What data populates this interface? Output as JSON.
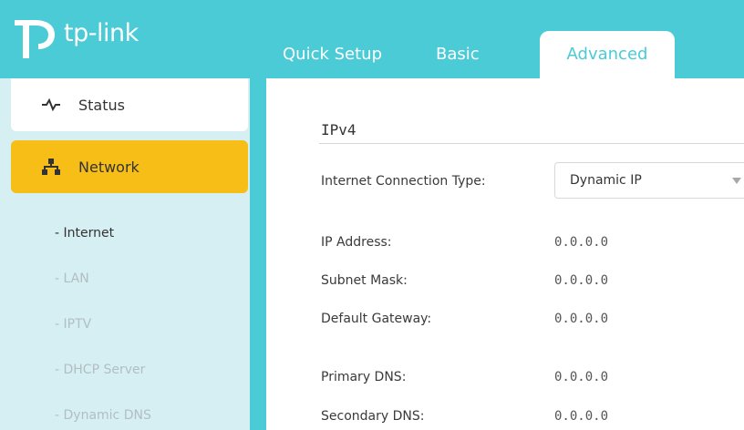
{
  "brand": {
    "logo_text": "tp-link"
  },
  "header": {
    "tabs": [
      {
        "label": "Quick Setup",
        "active": false
      },
      {
        "label": "Basic",
        "active": false
      },
      {
        "label": "Advanced",
        "active": true
      }
    ]
  },
  "sidebar": {
    "items": [
      {
        "label": "Status",
        "icon": "pulse-icon",
        "selected": false
      },
      {
        "label": "Network",
        "icon": "network-icon",
        "selected": true
      }
    ],
    "subitems": [
      {
        "label": "- Internet",
        "active": true
      },
      {
        "label": "- LAN",
        "active": false
      },
      {
        "label": "- IPTV",
        "active": false
      },
      {
        "label": "- DHCP Server",
        "active": false
      },
      {
        "label": "- Dynamic DNS",
        "active": false
      }
    ]
  },
  "main": {
    "section_title": "IPv4",
    "connection_type": {
      "label": "Internet Connection Type:",
      "value": "Dynamic IP"
    },
    "fields": [
      {
        "label": "IP Address:",
        "value": "0.0.0.0"
      },
      {
        "label": "Subnet Mask:",
        "value": "0.0.0.0"
      },
      {
        "label": "Default Gateway:",
        "value": "0.0.0.0"
      },
      {
        "label": "Primary DNS:",
        "value": "0.0.0.0"
      },
      {
        "label": "Secondary DNS:",
        "value": "0.0.0.0"
      }
    ]
  },
  "colors": {
    "brand_teal": "#4acbd6",
    "selected_yellow": "#f6be17",
    "sidebar_bg": "#d6eff2"
  }
}
